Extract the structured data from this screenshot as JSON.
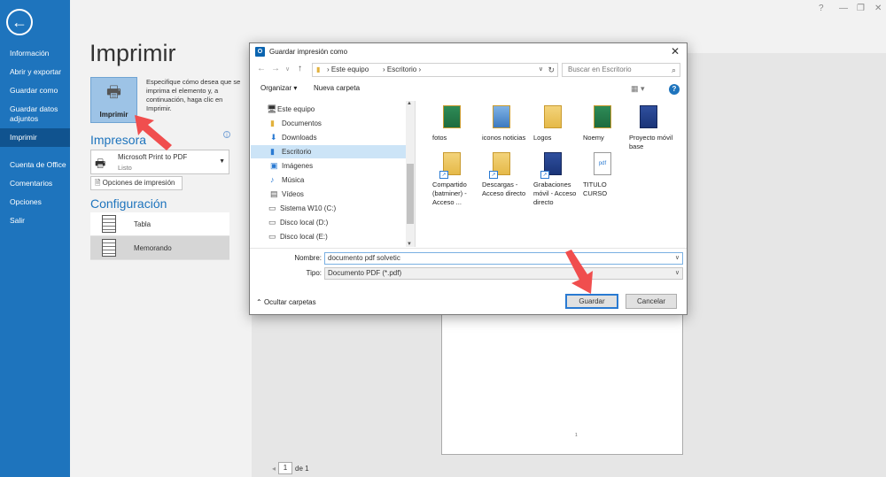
{
  "nav": {
    "items": [
      {
        "label": "Información",
        "active": false
      },
      {
        "label": "Abrir y exportar",
        "active": false
      },
      {
        "label": "Guardar como",
        "active": false
      },
      {
        "label": "Guardar datos adjuntos",
        "active": false
      },
      {
        "label": "Imprimir",
        "active": true
      },
      {
        "label": "Cuenta de Office",
        "active": false
      },
      {
        "label": "Comentarios",
        "active": false
      },
      {
        "label": "Opciones",
        "active": false
      },
      {
        "label": "Salir",
        "active": false
      }
    ]
  },
  "print": {
    "title": "Imprimir",
    "tile_label": "Imprimir",
    "description": "Especifique cómo desea que se imprima el elemento y, a continuación, haga clic en Imprimir.",
    "printer_heading": "Impresora",
    "printer_name": "Microsoft Print to PDF",
    "printer_status": "Listo",
    "options_button": "Opciones de impresión",
    "settings_heading": "Configuración",
    "styles": [
      {
        "label": "Tabla",
        "selected": false
      },
      {
        "label": "Memorando",
        "selected": true
      }
    ],
    "pager_current": "1",
    "pager_total": "de 1",
    "page_marker": "1"
  },
  "dialog": {
    "title": "Guardar impresión como",
    "breadcrumb": [
      "Este equipo",
      "Escritorio"
    ],
    "search_placeholder": "Buscar en Escritorio",
    "organize": "Organizar ▾",
    "new_folder": "Nueva carpeta",
    "tree": [
      {
        "label": "Este equipo",
        "icon": "computer-icon",
        "selected": false
      },
      {
        "label": "Documentos",
        "icon": "folder-icon",
        "selected": false
      },
      {
        "label": "Downloads",
        "icon": "download-icon",
        "selected": false
      },
      {
        "label": "Escritorio",
        "icon": "folder-icon",
        "selected": true
      },
      {
        "label": "Imágenes",
        "icon": "image-icon",
        "selected": false
      },
      {
        "label": "Música",
        "icon": "music-icon",
        "selected": false
      },
      {
        "label": "Vídeos",
        "icon": "video-icon",
        "selected": false
      },
      {
        "label": "Sistema W10 (C:)",
        "icon": "drive-icon",
        "selected": false
      },
      {
        "label": "Disco local (D:)",
        "icon": "drive-icon",
        "selected": false
      },
      {
        "label": "Disco local (E:)",
        "icon": "drive-icon",
        "selected": false
      }
    ],
    "files": [
      {
        "label": "fotos",
        "kind": "folder"
      },
      {
        "label": "iconos noticias",
        "kind": "folder"
      },
      {
        "label": "Logos",
        "kind": "folder"
      },
      {
        "label": "Noemy",
        "kind": "folder"
      },
      {
        "label": "Proyecto móvil base",
        "kind": "folder"
      },
      {
        "label": "Compartido (batminer) - Acceso ...",
        "kind": "shortcut"
      },
      {
        "label": "Descargas - Acceso directo",
        "kind": "shortcut"
      },
      {
        "label": "Grabaciones móvil - Acceso directo",
        "kind": "shortcut"
      },
      {
        "label": "TITULO CURSO",
        "kind": "pdf"
      }
    ],
    "name_label": "Nombre:",
    "name_value": "documento pdf solvetic",
    "type_label": "Tipo:",
    "type_value": "Documento PDF (*.pdf)",
    "hide_folders": "Ocultar carpetas",
    "save_button": "Guardar",
    "cancel_button": "Cancelar"
  },
  "colors": {
    "nav_bg": "#1e74bd",
    "nav_active": "#10538f",
    "accent": "#2a7ad2",
    "annotation_arrow": "#f04e4e"
  }
}
